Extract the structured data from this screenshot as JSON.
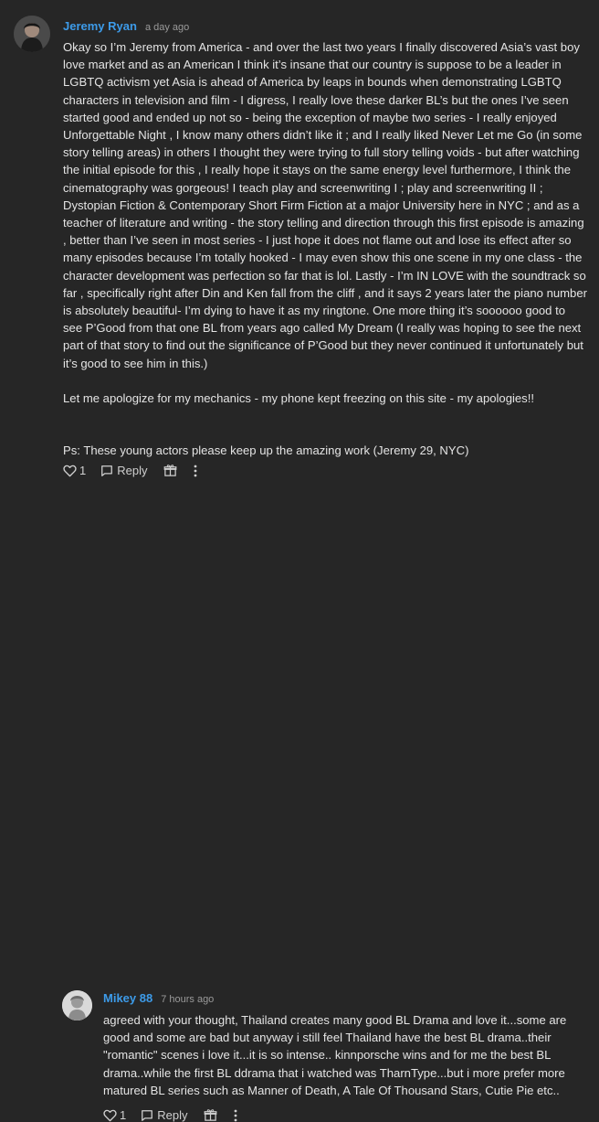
{
  "comments": [
    {
      "author": "Jeremy Ryan",
      "time": "a day ago",
      "paragraphs": [
        "Okay so I’m Jeremy from America - and over the last two years I finally discovered Asia’s vast boy love market and as an American I think it’s insane that our country is suppose to be a leader in LGBTQ activism yet Asia is ahead of America by leaps in bounds when demonstrating LGBTQ characters in television and film - I digress, I really love these darker BL’s but the ones I’ve seen started good and ended up not so - being the exception of maybe two series - I really enjoyed Unforgettable Night , I know many others didn’t like it ; and I really liked Never Let me Go (in some story telling areas) in others I thought they were trying to full story telling voids - but after watching the initial episode for this , I really hope it stays on the same energy level furthermore, I think the cinematography was gorgeous! I teach play and screenwriting I ; play and screenwriting II ; Dystopian Fiction & Contemporary Short Firm Fiction at a major University here in NYC ; and as a teacher of literature and writing - the story telling and direction through this first episode is amazing , better than I’ve seen in most series - I just hope it does not flame out and lose its effect after so many episodes because I’m totally hooked - I may even show this one scene in my one class - the character development was perfection so far that is lol. Lastly - I’m IN LOVE with the soundtrack so far , specifically right after Din and Ken fall from the cliff , and it says 2 years later the piano number is absolutely beautiful- I’m dying to have it as my ringtone. One more thing it’s soooooo good to see P’Good from that one BL from years ago called My Dream (I really was hoping to see the next part of that story to find out the significance of P’Good but they never continued it unfortunately but it’s good to see him in this.)",
        "Let me apologize for my mechanics - my phone kept freezing on this site - my apologies!!",
        "Ps: These young actors please keep up the amazing work (Jeremy 29, NYC)"
      ],
      "likes": "1",
      "reply_label": "Reply"
    },
    {
      "author": "Mikey 88",
      "time": "7 hours ago",
      "paragraphs": [
        "agreed with your thought, Thailand creates many good BL Drama and love it...some are good and some are bad but anyway i still feel Thailand have the best BL drama..their \"romantic\" scenes i love it...it is so intense.. kinnporsche wins and for me the best BL drama..while the first BL ddrama that i watched was TharnType...but i more prefer more matured BL series such as Manner of Death, A Tale Of Thousand Stars, Cutie Pie etc.."
      ],
      "likes": "1",
      "reply_label": "Reply"
    }
  ],
  "icons": {
    "like": "heart-icon",
    "reply": "reply-bubble-icon",
    "gift": "gift-icon",
    "more": "more-vertical-icon"
  },
  "colors": {
    "background": "#262626",
    "author": "#3d9be9",
    "timestamp": "#9a9a9a",
    "text": "#e4e4e4"
  }
}
